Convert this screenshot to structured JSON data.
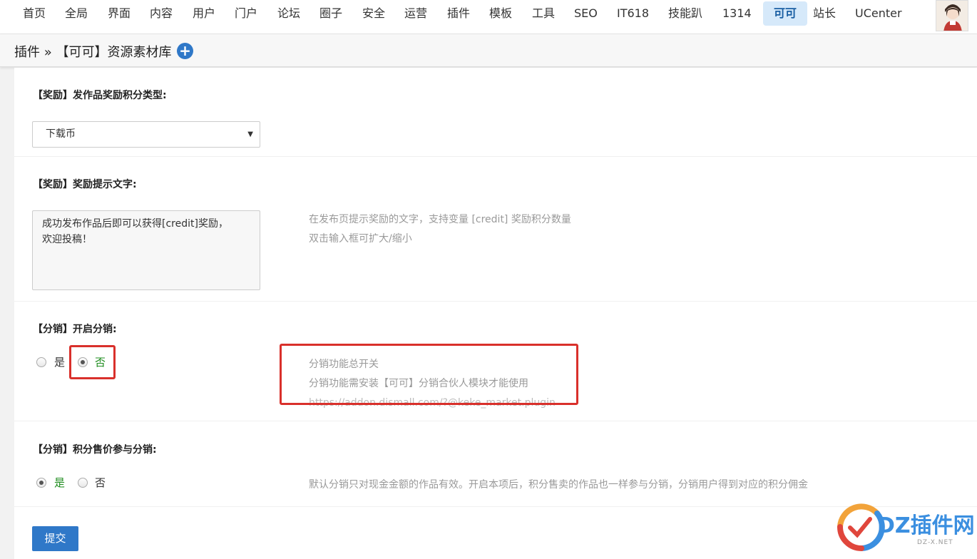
{
  "nav": {
    "items": [
      "首页",
      "全局",
      "界面",
      "内容",
      "用户",
      "门户",
      "论坛",
      "圈子",
      "安全",
      "运营",
      "插件",
      "模板",
      "工具",
      "SEO",
      "IT618",
      "技能趴",
      "1314",
      "可可",
      "站长",
      "UCenter"
    ],
    "active": "可可"
  },
  "breadcrumb": {
    "text": "插件 » 【可可】资源素材库",
    "add_icon": "plus-circle-icon"
  },
  "sections": {
    "reward_type": {
      "title": "【奖励】发作品奖励积分类型:",
      "selected": "下载币"
    },
    "reward_text": {
      "title": "【奖励】奖励提示文字:",
      "value": "成功发布作品后即可以获得[credit]奖励，\n欢迎投稿！",
      "hint_line1": "在发布页提示奖励的文字，支持变量 [credit] 奖励积分数量",
      "hint_line2": "双击输入框可扩大/缩小"
    },
    "distribution": {
      "title": "【分销】开启分销:",
      "yes": "是",
      "no": "否",
      "selected": "否",
      "hint_line1": "分销功能总开关",
      "hint_line2": "分销功能需安装【可可】分销合伙人模块才能使用",
      "hint_line3": "https://addon.dismall.com/?@keke_market.plugin"
    },
    "credit_distribution": {
      "title": "【分销】积分售价参与分销:",
      "yes": "是",
      "no": "否",
      "selected": "是",
      "hint": "默认分销只对现金金额的作品有效。开启本项后，积分售卖的作品也一样参与分销，分销用户得到对应的积分佣金"
    }
  },
  "submit_label": "提交",
  "watermark": {
    "brand": "DZ插件网",
    "url": "DZ-X.NET"
  },
  "colors": {
    "accent": "#2f78c8",
    "highlight": "#d9302b",
    "active_nav_bg": "#d6e9fa",
    "radio_on_text": "#1e8c1e"
  }
}
